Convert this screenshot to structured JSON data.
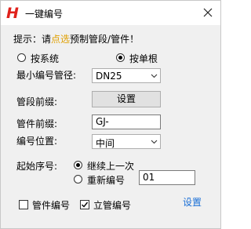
{
  "window": {
    "title": "一键编号",
    "logo_letter": "H",
    "logo_color": "#e0211b",
    "close_icon": "close-icon"
  },
  "hint": {
    "prefix": "提示：请",
    "accent": "点选",
    "suffix": "预制管段/管件！",
    "accent_color": "#e0a000"
  },
  "mode": {
    "option_system": "按系统",
    "option_single": "按单根",
    "selected": "option_single"
  },
  "min_pipe": {
    "label": "最小编号管径:",
    "value": "DN25"
  },
  "segment_prefix": {
    "label": "管段前缀:",
    "button": "设置"
  },
  "fitting_prefix": {
    "label": "管件前缀:",
    "value": "GJ-"
  },
  "position": {
    "label": "编号位置:",
    "value": "中间"
  },
  "start": {
    "label": "起始序号:",
    "option_continue": "继续上一次",
    "option_renumber": "重新编号",
    "renumber_value": "01",
    "selected": "option_continue"
  },
  "footer": {
    "fitting_number": {
      "label": "管件编号",
      "checked": false
    },
    "riser_number": {
      "label": "立管编号",
      "checked": true
    },
    "settings_link": "设置",
    "link_color": "#1a6fd6"
  }
}
